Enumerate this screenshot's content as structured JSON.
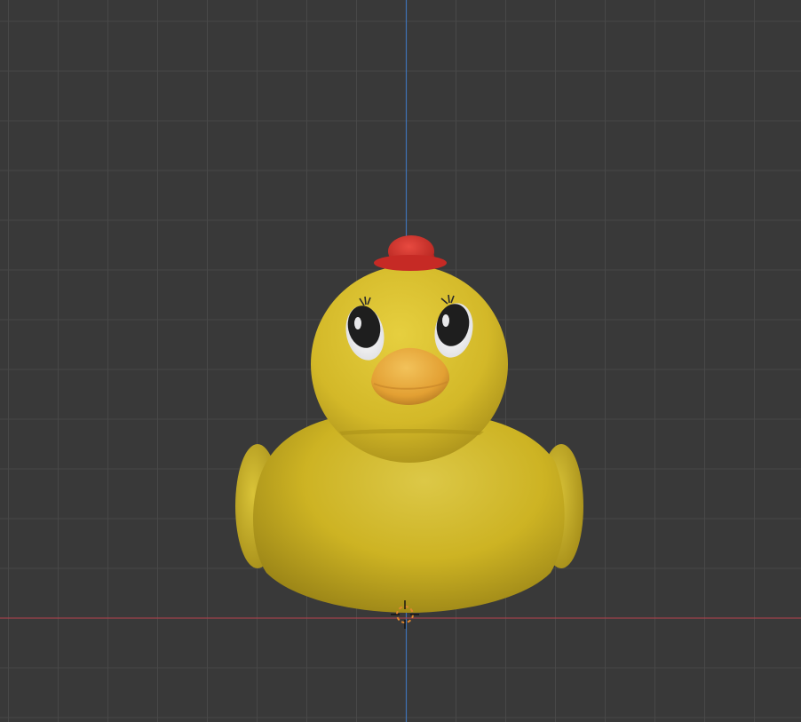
{
  "viewport": {
    "background_color": "#393939",
    "grid_color": "#484848",
    "x_axis_color": "#a0414b",
    "y_axis_color": "#3f73b5"
  },
  "scene_object": {
    "body_color": "#d6bc2c",
    "head_color": "#dcc232",
    "hat_color": "#d8322d",
    "beak_color": "#e8a83a",
    "eye_color": "#1e1e1e"
  },
  "cursor_3d": {
    "icon": "3d-cursor-icon",
    "ring_color": "#e0862f"
  }
}
